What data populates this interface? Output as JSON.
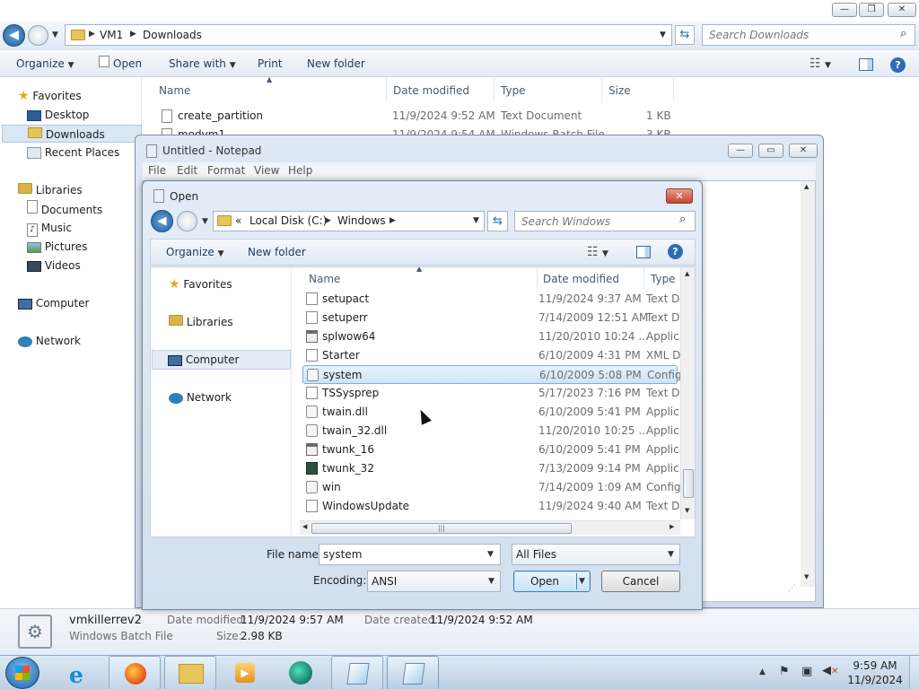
{
  "explorer": {
    "breadcrumb": [
      "VM1",
      "Downloads"
    ],
    "search_placeholder": "Search Downloads",
    "toolbar": {
      "organize": "Organize",
      "open": "Open",
      "share_with": "Share with",
      "print": "Print",
      "new_folder": "New folder"
    },
    "sidebar": {
      "favorites": "Favorites",
      "desktop": "Desktop",
      "downloads": "Downloads",
      "recent_places": "Recent Places",
      "libraries": "Libraries",
      "documents": "Documents",
      "music": "Music",
      "pictures": "Pictures",
      "videos": "Videos",
      "computer": "Computer",
      "network": "Network"
    },
    "columns": {
      "name": "Name",
      "date": "Date modified",
      "type": "Type",
      "size": "Size"
    },
    "files": [
      {
        "name": "create_partition",
        "date": "11/9/2024 9:52 AM",
        "type": "Text Document",
        "size": "1 KB"
      },
      {
        "name": "modvm1",
        "date": "11/9/2024 9:54 AM",
        "type": "Windows Batch File",
        "size": "3 KB"
      }
    ]
  },
  "notepad": {
    "title": "Untitled - Notepad",
    "menu": [
      "File",
      "Edit",
      "Format",
      "View",
      "Help"
    ]
  },
  "dialog": {
    "title": "Open",
    "path": {
      "prefix": "«",
      "drive": "Local Disk (C:)",
      "folder": "Windows"
    },
    "search_placeholder": "Search Windows",
    "toolbar": {
      "organize": "Organize",
      "new_folder": "New folder"
    },
    "sidebar": {
      "favorites": "Favorites",
      "libraries": "Libraries",
      "computer": "Computer",
      "network": "Network"
    },
    "columns": {
      "name": "Name",
      "date": "Date modified",
      "type": "Type"
    },
    "files": [
      {
        "name": "setupact",
        "date": "11/9/2024 9:37 AM",
        "type": "Text D",
        "icon": "text-file"
      },
      {
        "name": "setuperr",
        "date": "7/14/2009 12:51 AM",
        "type": "Text D",
        "icon": "text-file"
      },
      {
        "name": "splwow64",
        "date": "11/20/2010 10:24 ...",
        "type": "Applic",
        "icon": "app"
      },
      {
        "name": "Starter",
        "date": "6/10/2009 4:31 PM",
        "type": "XML D",
        "icon": "text-file"
      },
      {
        "name": "system",
        "date": "6/10/2009 5:08 PM",
        "type": "Config",
        "icon": "config"
      },
      {
        "name": "TSSysprep",
        "date": "5/17/2023 7:16 PM",
        "type": "Text D",
        "icon": "text-file"
      },
      {
        "name": "twain.dll",
        "date": "6/10/2009 5:41 PM",
        "type": "Applic",
        "icon": "config"
      },
      {
        "name": "twain_32.dll",
        "date": "11/20/2010 10:25 ...",
        "type": "Applic",
        "icon": "config"
      },
      {
        "name": "twunk_16",
        "date": "6/10/2009 5:41 PM",
        "type": "Applic",
        "icon": "app"
      },
      {
        "name": "twunk_32",
        "date": "7/13/2009 9:14 PM",
        "type": "Applic",
        "icon": "app-dark"
      },
      {
        "name": "win",
        "date": "7/14/2009 1:09 AM",
        "type": "Config",
        "icon": "config"
      },
      {
        "name": "WindowsUpdate",
        "date": "11/9/2024 9:40 AM",
        "type": "Text D",
        "icon": "text-file"
      }
    ],
    "file_name_label": "File name:",
    "file_name_value": "system",
    "filter_value": "All Files",
    "encoding_label": "Encoding:",
    "encoding_value": "ANSI",
    "open_button": "Open",
    "cancel_button": "Cancel"
  },
  "details": {
    "name": "vmkillerrev2",
    "type": "Windows Batch File",
    "date_modified_label": "Date modified:",
    "date_modified": "11/9/2024 9:57 AM",
    "date_created_label": "Date created:",
    "date_created": "11/9/2024 9:52 AM",
    "size_label": "Size:",
    "size": "2.98 KB"
  },
  "taskbar": {
    "time": "9:59 AM",
    "date": "11/9/2024"
  },
  "colors": {
    "accent": "#3c7fb1",
    "selection": "#cce8ff",
    "taskbar": "#c9dcec",
    "close_red": "#c7432f"
  }
}
